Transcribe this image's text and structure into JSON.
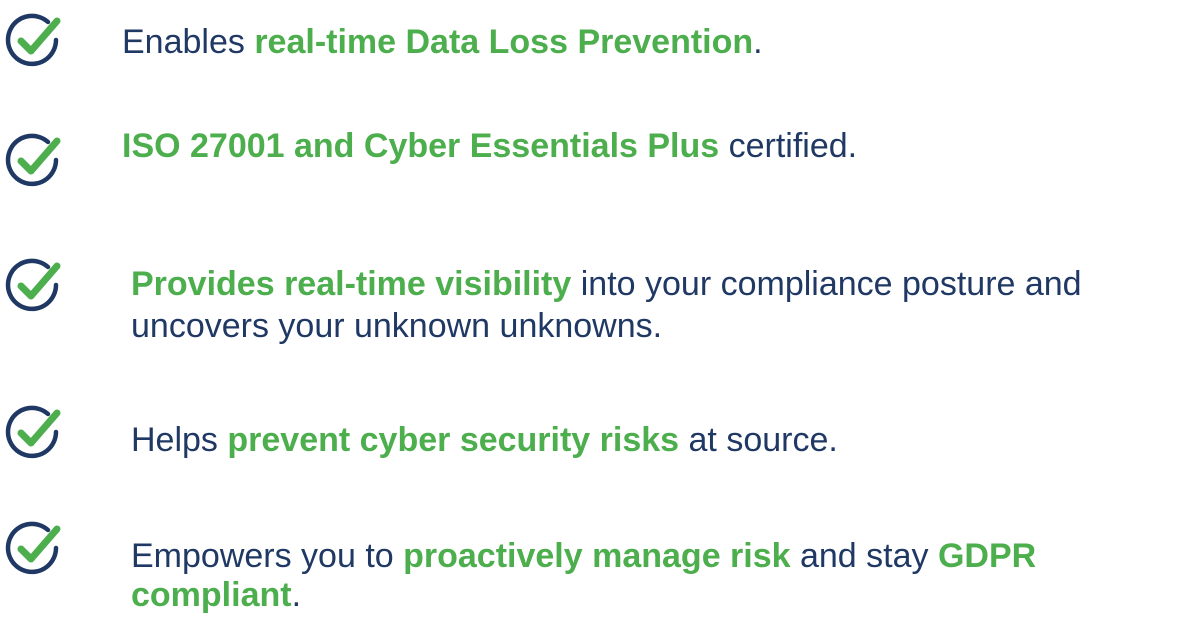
{
  "colors": {
    "check": "#4cae4c",
    "circle": "#1f3864",
    "text": "#1f3864",
    "highlight": "#4cae4c"
  },
  "icon": "check-circle-icon",
  "items": [
    {
      "segments": [
        {
          "t": "Enables "
        },
        {
          "t": "real-time Data Loss Prevention",
          "hl": true
        },
        {
          "t": "."
        }
      ]
    },
    {
      "segments": [
        {
          "t": "ISO 27001 and Cyber Essentials Plus",
          "hl": true
        },
        {
          "t": " certified."
        }
      ]
    },
    {
      "segments": [
        {
          "t": "Provides real-time visibility",
          "hl": true
        },
        {
          "t": " into your compliance posture and"
        }
      ],
      "line2": [
        {
          "t": "uncovers your unknown unknowns."
        }
      ]
    },
    {
      "segments": [
        {
          "t": "Helps "
        },
        {
          "t": "prevent cyber security risks",
          "hl": true
        },
        {
          "t": " at source."
        }
      ]
    },
    {
      "segments": [
        {
          "t": "Empowers you to "
        },
        {
          "t": "proactively manage risk",
          "hl": true
        },
        {
          "t": " and stay "
        },
        {
          "t": "GDPR",
          "hl": true
        }
      ],
      "line2": [
        {
          "t": "compliant",
          "hl": true
        },
        {
          "t": "."
        }
      ]
    }
  ]
}
